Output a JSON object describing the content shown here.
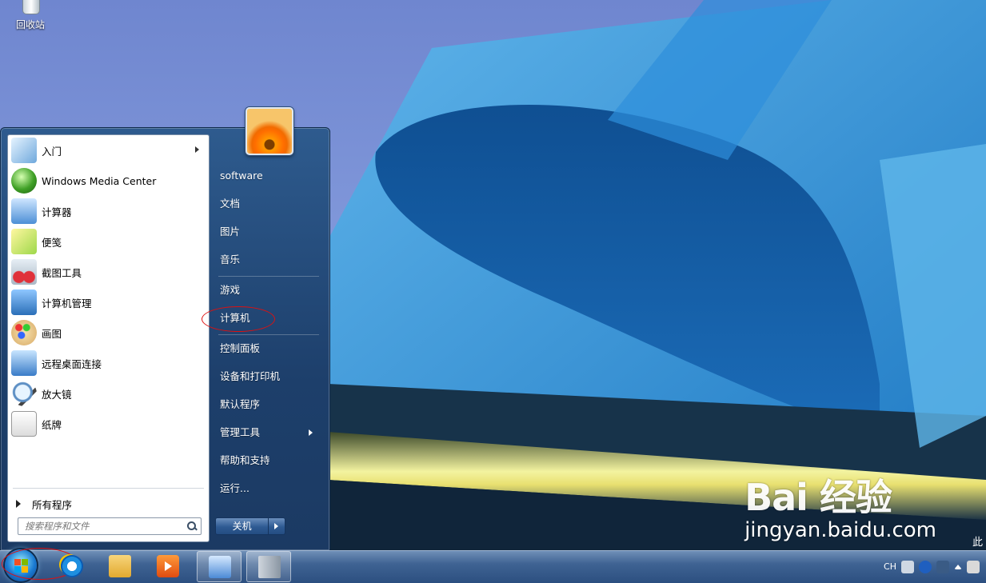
{
  "desktop": {
    "icons": [
      {
        "label": "回收站",
        "icon": "recycle-bin-icon"
      }
    ],
    "watermark": {
      "logo": "Bai 经验",
      "url": "jingyan.baidu.com",
      "side_text": "此"
    }
  },
  "start_menu": {
    "programs": [
      {
        "label": "入门",
        "icon": "getting-started-icon",
        "has_submenu": true
      },
      {
        "label": "Windows Media Center",
        "icon": "media-center-icon",
        "has_submenu": false
      },
      {
        "label": "计算器",
        "icon": "calculator-icon",
        "has_submenu": false
      },
      {
        "label": "便笺",
        "icon": "sticky-notes-icon",
        "has_submenu": false
      },
      {
        "label": "截图工具",
        "icon": "snipping-tool-icon",
        "has_submenu": false
      },
      {
        "label": "计算机管理",
        "icon": "computer-management-icon",
        "has_submenu": false
      },
      {
        "label": "画图",
        "icon": "paint-icon",
        "has_submenu": false
      },
      {
        "label": "远程桌面连接",
        "icon": "remote-desktop-icon",
        "has_submenu": false
      },
      {
        "label": "放大镜",
        "icon": "magnifier-icon",
        "has_submenu": false
      },
      {
        "label": "纸牌",
        "icon": "solitaire-icon",
        "has_submenu": false
      }
    ],
    "all_programs": "所有程序",
    "search_placeholder": "搜索程序和文件",
    "right_items": [
      {
        "label": "software"
      },
      {
        "label": "文档"
      },
      {
        "label": "图片"
      },
      {
        "label": "音乐"
      },
      {
        "label": "游戏"
      },
      {
        "label": "计算机",
        "highlighted": true
      },
      {
        "label": "控制面板"
      },
      {
        "label": "设备和打印机"
      },
      {
        "label": "默认程序"
      },
      {
        "label": "管理工具",
        "has_submenu": true
      },
      {
        "label": "帮助和支持"
      },
      {
        "label": "运行..."
      }
    ],
    "shutdown_label": "关机"
  },
  "taskbar": {
    "pinned": [
      {
        "name": "internet-explorer-icon"
      },
      {
        "name": "windows-explorer-icon"
      },
      {
        "name": "media-player-icon"
      },
      {
        "name": "remote-desktop-taskbar-icon",
        "active": true
      },
      {
        "name": "server-manager-icon",
        "active": true
      }
    ],
    "tray": {
      "language": "CH"
    }
  },
  "colors": {
    "accent": "#1b3a63",
    "highlight_circle": "#dd1111"
  }
}
